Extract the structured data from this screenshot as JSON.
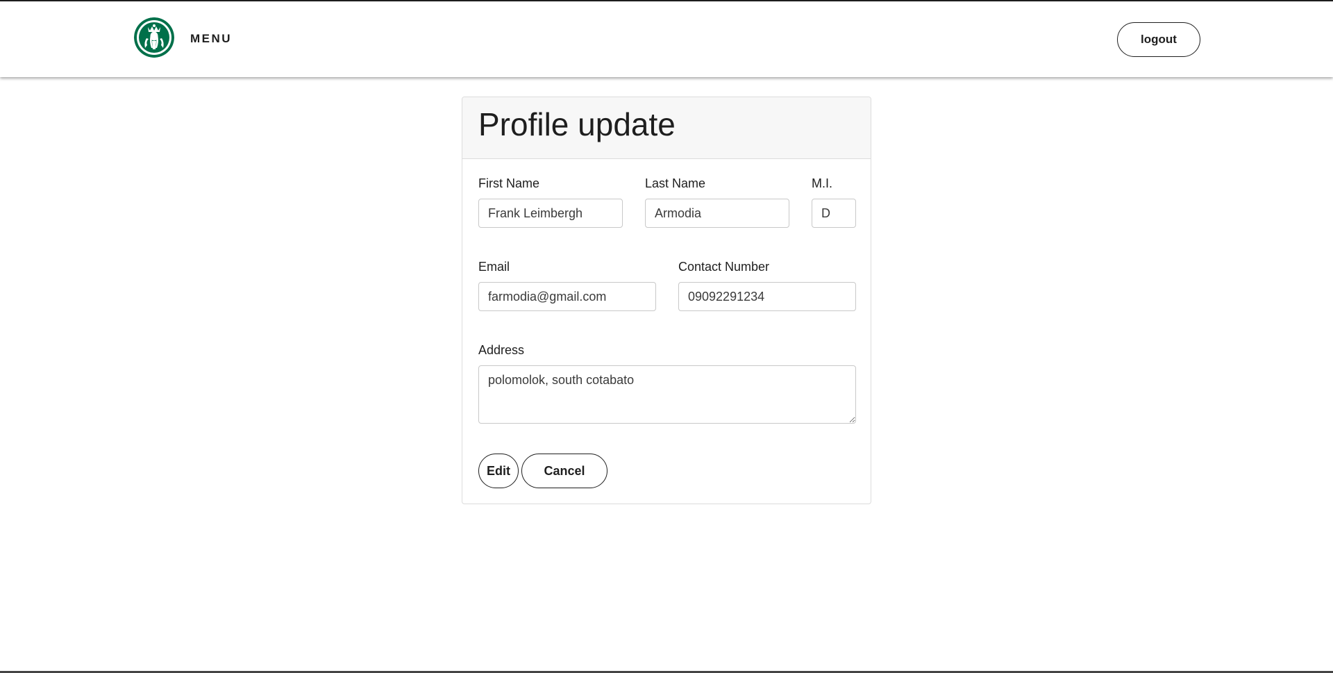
{
  "header": {
    "menu_label": "MENU",
    "logout_label": "logout",
    "logo_icon": "starbucks-siren-logo-icon",
    "brand_color": "#00704a"
  },
  "form": {
    "title": "Profile update",
    "first_name": {
      "label": "First Name",
      "value": "Frank Leimbergh"
    },
    "last_name": {
      "label": "Last Name",
      "value": "Armodia"
    },
    "middle_initial": {
      "label": "M.I.",
      "value": "D"
    },
    "email": {
      "label": "Email",
      "value": "farmodia@gmail.com"
    },
    "contact_number": {
      "label": "Contact Number",
      "value": "09092291234"
    },
    "address": {
      "label": "Address",
      "value": "polomolok, south cotabato"
    },
    "edit_label": "Edit",
    "cancel_label": "Cancel"
  }
}
